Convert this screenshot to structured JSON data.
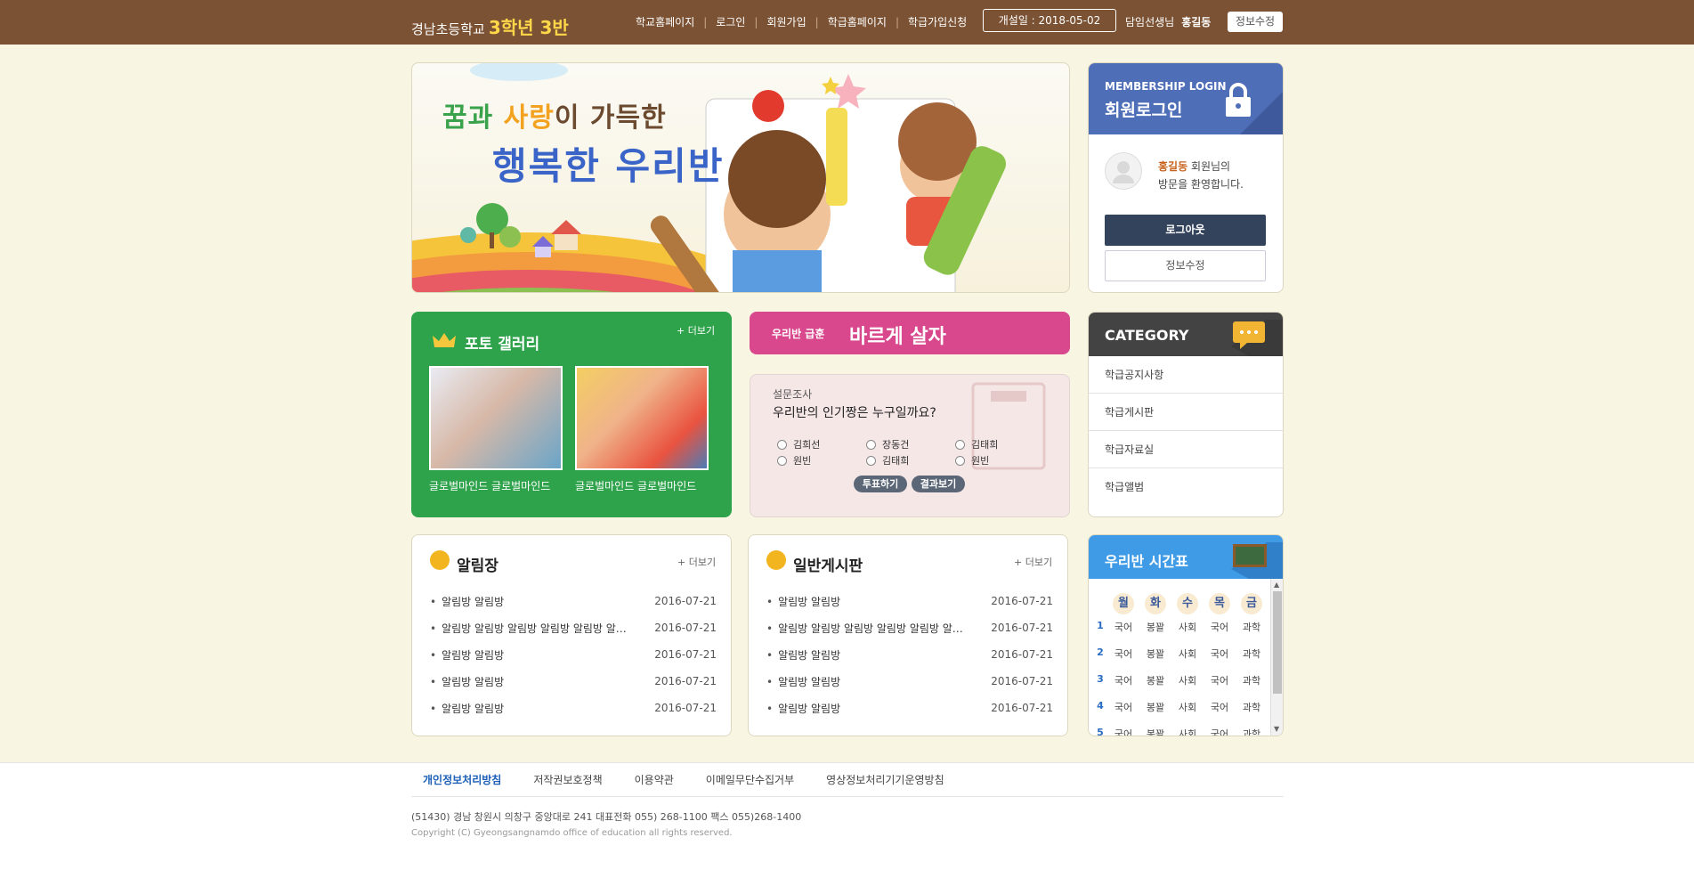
{
  "header": {
    "school": "경남초등학교",
    "class": "3학년 3반",
    "nav": [
      "학교홈페이지",
      "로그인",
      "회원가입",
      "학급홈페이지",
      "학급가입신청"
    ],
    "open_date": "개설일 : 2018-05-02",
    "teacher_label": "담임선생님",
    "teacher_name": "홍길동",
    "edit_label": "정보수정"
  },
  "banner": {
    "line1_a": "꿈과 ",
    "line1_b": "사랑",
    "line1_c": "이 가득한",
    "line2": "행복한 우리반"
  },
  "login": {
    "en_title": "MEMBERSHIP LOGIN",
    "ko_title": "회원로그인",
    "user": "홍길동",
    "welcome1": " 회원님의",
    "welcome2": "방문을 환영합니다.",
    "logout": "로그아웃",
    "edit": "정보수정"
  },
  "gallery": {
    "title": "포토 갤러리",
    "more": "+ 더보기",
    "captions": [
      "글로벌마인드 글로벌마인드",
      "글로벌마인드 글로벌마인드"
    ]
  },
  "motto": {
    "label": "우리반 급훈",
    "text": "바르게 살자"
  },
  "survey": {
    "label": "설문조사",
    "question": "우리반의 인기짱은 누구일까요?",
    "options": [
      "김희선",
      "장동건",
      "김태희",
      "원빈",
      "김태희",
      "원빈"
    ],
    "vote": "투표하기",
    "results": "결과보기"
  },
  "category": {
    "title": "CATEGORY",
    "items": [
      "학급공지사항",
      "학급게시판",
      "학급자료실",
      "학급앨범"
    ]
  },
  "notice_board": {
    "title": "알림장",
    "more": "+ 더보기",
    "posts": [
      {
        "title": "알림방 알림방",
        "date": "2016-07-21"
      },
      {
        "title": "알림방 알림방 알림방 알림방 알림방 알림방",
        "date": "2016-07-21"
      },
      {
        "title": "알림방 알림방",
        "date": "2016-07-21"
      },
      {
        "title": "알림방 알림방",
        "date": "2016-07-21"
      },
      {
        "title": "알림방 알림방",
        "date": "2016-07-21"
      }
    ]
  },
  "general_board": {
    "title": "일반게시판",
    "more": "+ 더보기",
    "posts": [
      {
        "title": "알림방 알림방",
        "date": "2016-07-21"
      },
      {
        "title": "알림방 알림방 알림방 알림방 알림방 알림방",
        "date": "2016-07-21"
      },
      {
        "title": "알림방 알림방",
        "date": "2016-07-21"
      },
      {
        "title": "알림방 알림방",
        "date": "2016-07-21"
      },
      {
        "title": "알림방 알림방",
        "date": "2016-07-21"
      }
    ]
  },
  "timetable": {
    "title": "우리반 시간표",
    "days": [
      "월",
      "화",
      "수",
      "목",
      "금"
    ],
    "rows": [
      {
        "period": "1",
        "subjects": [
          "국어",
          "봉꽐",
          "사회",
          "국어",
          "과학"
        ]
      },
      {
        "period": "2",
        "subjects": [
          "국어",
          "봉꽐",
          "사회",
          "국어",
          "과학"
        ]
      },
      {
        "period": "3",
        "subjects": [
          "국어",
          "봉꽐",
          "사회",
          "국어",
          "과학"
        ]
      },
      {
        "period": "4",
        "subjects": [
          "국어",
          "봉꽐",
          "사회",
          "국어",
          "과학"
        ]
      },
      {
        "period": "5",
        "subjects": [
          "국어",
          "봉꽐",
          "사회",
          "국어",
          "과학"
        ]
      }
    ]
  },
  "footer": {
    "links": [
      "개인정보처리방침",
      "저작권보호정책",
      "이용약관",
      "이메일무단수집거부",
      "영상정보처리기기운영방침"
    ],
    "address": "(51430) 경남 창원시 의창구 중앙대로 241 대표전화 055) 268-1100 팩스 055)268-1400",
    "copyright": "Copyright (C) Gyeongsangnamdo office of education all rights reserved."
  }
}
